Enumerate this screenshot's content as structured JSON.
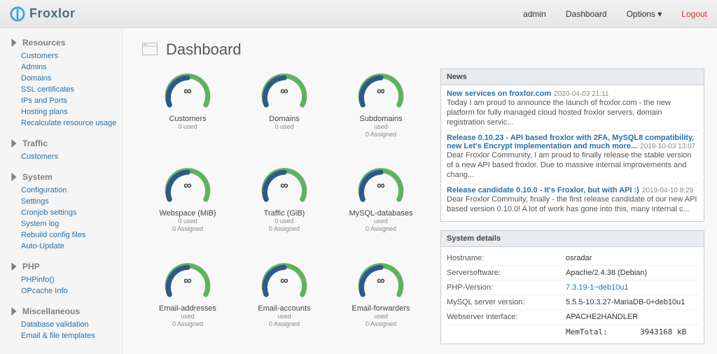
{
  "topbar": {
    "brand": "Froxlor",
    "user": "admin",
    "dashboard": "Dashboard",
    "options": "Options ▾",
    "logout": "Logout"
  },
  "sidebar": [
    {
      "title": "Resources",
      "items": [
        "Customers",
        "Admins",
        "Domains",
        "SSL certificates",
        "IPs and Ports",
        "Hosting plans",
        "Recalculate resource usage"
      ]
    },
    {
      "title": "Traffic",
      "items": [
        "Customers"
      ]
    },
    {
      "title": "System",
      "items": [
        "Configuration",
        "Settings",
        "Cronjob settings",
        "System log",
        "Rebuild config files",
        "Auto-Update"
      ]
    },
    {
      "title": "PHP",
      "items": [
        "PHPinfo()",
        "OPcache Info"
      ]
    },
    {
      "title": "Miscellaneous",
      "items": [
        "Database validation",
        "Email & file templates"
      ]
    }
  ],
  "page": {
    "title": "Dashboard"
  },
  "gauges": [
    {
      "value": "∞",
      "label": "Customers",
      "sub": [
        "0 used"
      ]
    },
    {
      "value": "∞",
      "label": "Domains",
      "sub": [
        "0 used"
      ]
    },
    {
      "value": "∞",
      "label": "Subdomains",
      "sub": [
        "used",
        "0 Assigned"
      ]
    },
    {
      "value": "∞",
      "label": "Webspace (MiB)",
      "sub": [
        "0 used",
        "0 Assigned"
      ]
    },
    {
      "value": "∞",
      "label": "Traffic (GiB)",
      "sub": [
        "0 used",
        "0 Assigned"
      ]
    },
    {
      "value": "∞",
      "label": "MySQL-databases",
      "sub": [
        "used",
        "0 Assigned"
      ]
    },
    {
      "value": "∞",
      "label": "Email-addresses",
      "sub": [
        "used",
        "0 Assigned"
      ]
    },
    {
      "value": "∞",
      "label": "Email-accounts",
      "sub": [
        "used",
        "0 Assigned"
      ]
    },
    {
      "value": "∞",
      "label": "Email-forwarders",
      "sub": [
        "used",
        "0 Assigned"
      ]
    }
  ],
  "news_heading": "News",
  "news": [
    {
      "title": "New services on froxlor.com",
      "date": "2020-04-03 21:11",
      "body": "Today I am proud to announce the launch of froxlor.com - the new platform for fully managed cloud hosted froxlor servers, domain registration servic..."
    },
    {
      "title": "Release 0.10.23 - API based froxlor with 2FA, MySQL8 compatibility, new Let's Encrypt implementation and much more...",
      "date": "2019-10-03 13:07",
      "body": "Dear Froxlor Community, I am proud to finally release the stable version of a new API based froxlor. Due to massive internal improvements and chang..."
    },
    {
      "title": "Release candidate 0.10.0 - It's Froxlor, but with API :)",
      "date": "2019-04-10 8:29",
      "body": "Dear Froxlor Commuity, finally - the first release candidate of our new API based version 0.10.0! A lot of work has gone into this, many internal c..."
    }
  ],
  "system_heading": "System details",
  "system": [
    {
      "label": "Hostname:",
      "value": "osradar",
      "link": false
    },
    {
      "label": "Serversoftware:",
      "value": "Apache/2.4.38 (Debian)",
      "link": false
    },
    {
      "label": "PHP-Version:",
      "value": "7.3.19-1~deb10u1",
      "link": true
    },
    {
      "label": "MySQL server version:",
      "value": "5.5.5-10.3.27-MariaDB-0+deb10u1",
      "link": false
    },
    {
      "label": "Webserver interface:",
      "value": "APACHE2HANDLER",
      "link": false
    },
    {
      "label": "",
      "value": "MemTotal:       3943168 kB",
      "mono": true
    }
  ]
}
